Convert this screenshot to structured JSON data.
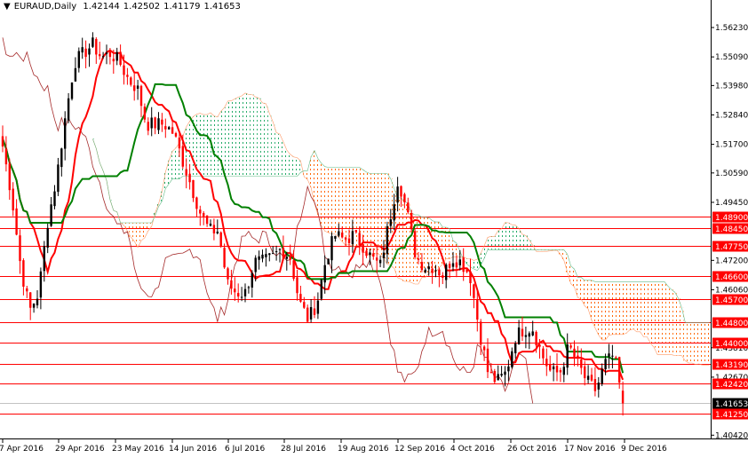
{
  "header": {
    "symbol": "EURAUD,Daily",
    "open": "1.42144",
    "high": "1.42502",
    "low": "1.41179",
    "close": "1.41653"
  },
  "colors": {
    "bull": "#000000",
    "bear": "#ff0000",
    "tenkan": "#ff0000",
    "kijun": "#008000",
    "chikou": "#a52a2a",
    "cloud_bear": "#ff6600",
    "cloud_bull": "#22aa66",
    "level_line": "#ff0000",
    "current_label": "#000000"
  },
  "chart_data": {
    "type": "candlestick",
    "title": "EURAUD,Daily",
    "ylim": [
      1.4025,
      1.5685
    ],
    "y_ticks": [
      "1.56230",
      "1.55090",
      "1.53980",
      "1.52840",
      "1.51700",
      "1.50590",
      "1.49450",
      "1.47200",
      "1.46060",
      "1.43810",
      "1.42670",
      "1.40420"
    ],
    "x_ticks": [
      "7 Apr 2016",
      "29 Apr 2016",
      "23 May 2016",
      "14 Jun 2016",
      "6 Jul 2016",
      "28 Jul 2016",
      "19 Aug 2016",
      "12 Sep 2016",
      "4 Oct 2016",
      "26 Oct 2016",
      "17 Nov 2016",
      "9 Dec 2016"
    ],
    "approx_closes": [
      1.5162,
      1.4972,
      1.4697,
      1.4525,
      1.4594,
      1.4869,
      1.5041,
      1.5282,
      1.5489,
      1.5523,
      1.5558,
      1.5506,
      1.5523,
      1.5489,
      1.542,
      1.5386,
      1.5248,
      1.5248,
      1.5248,
      1.5213,
      1.511,
      1.5007,
      1.4904,
      1.4835,
      1.4835,
      1.4628,
      1.4594,
      1.4594,
      1.4714,
      1.4714,
      1.4731,
      1.4766,
      1.4731,
      1.4559,
      1.449,
      1.4559,
      1.4731,
      1.4817,
      1.48,
      1.4817,
      1.4783,
      1.4731,
      1.4697,
      1.4869,
      1.5041,
      1.4904,
      1.4731,
      1.4697,
      1.4697,
      1.4663,
      1.4731,
      1.4714,
      1.4663,
      1.4456,
      1.4284,
      1.4249,
      1.4284,
      1.4422,
      1.4456,
      1.4456,
      1.4353,
      1.4284,
      1.4284,
      1.4387,
      1.4318,
      1.4249,
      1.4215,
      1.4318,
      1.4353,
      1.41653
    ],
    "levels": [
      "1.48900",
      "1.48450",
      "1.47750",
      "1.46600",
      "1.45700",
      "1.44800",
      "1.44000",
      "1.43190",
      "1.42420",
      "1.41250"
    ],
    "current_price": "1.41653",
    "indicators": [
      "Ichimoku Tenkan-sen",
      "Ichimoku Kijun-sen",
      "Senkou Span cloud",
      "Chikou Span"
    ]
  }
}
